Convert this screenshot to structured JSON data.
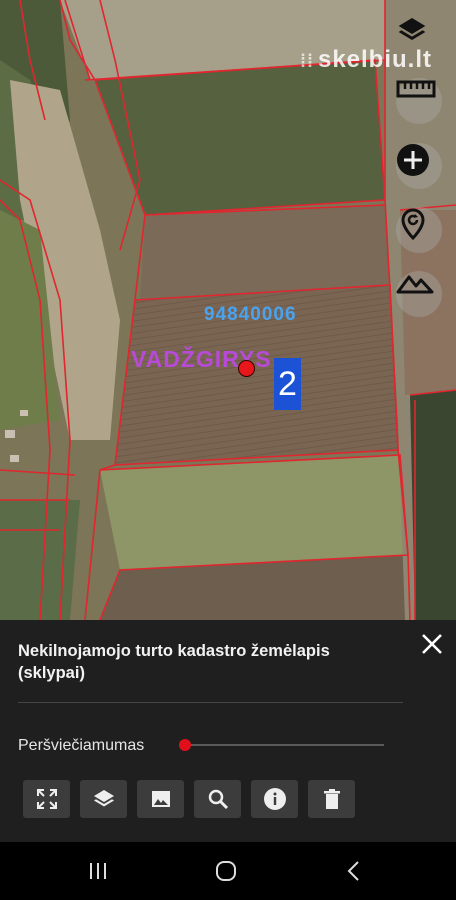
{
  "map": {
    "watermark": "skelbiu.lt",
    "parcel_number": "94840006",
    "place_name": "VADŽGIRYS",
    "badge_number": "2",
    "controls": [
      {
        "name": "layers-icon"
      },
      {
        "name": "ruler-icon"
      },
      {
        "name": "zoom-in-icon"
      },
      {
        "name": "locate-icon"
      },
      {
        "name": "terrain-icon"
      }
    ]
  },
  "panel": {
    "title": "Nekilnojamojo turto kadastro žemėlapis (sklypai)",
    "opacity_label": "Peršviečiamumas",
    "opacity_value": 0,
    "tools": [
      "fullscreen-icon",
      "layers-icon",
      "image-icon",
      "search-icon",
      "info-icon",
      "delete-icon"
    ]
  },
  "colors": {
    "parcel_border": "#e0262e",
    "accent": "#e0101a",
    "badge": "#1b52d6",
    "parcel_label": "#4aa3f0",
    "place_label": "#b84ad8"
  }
}
